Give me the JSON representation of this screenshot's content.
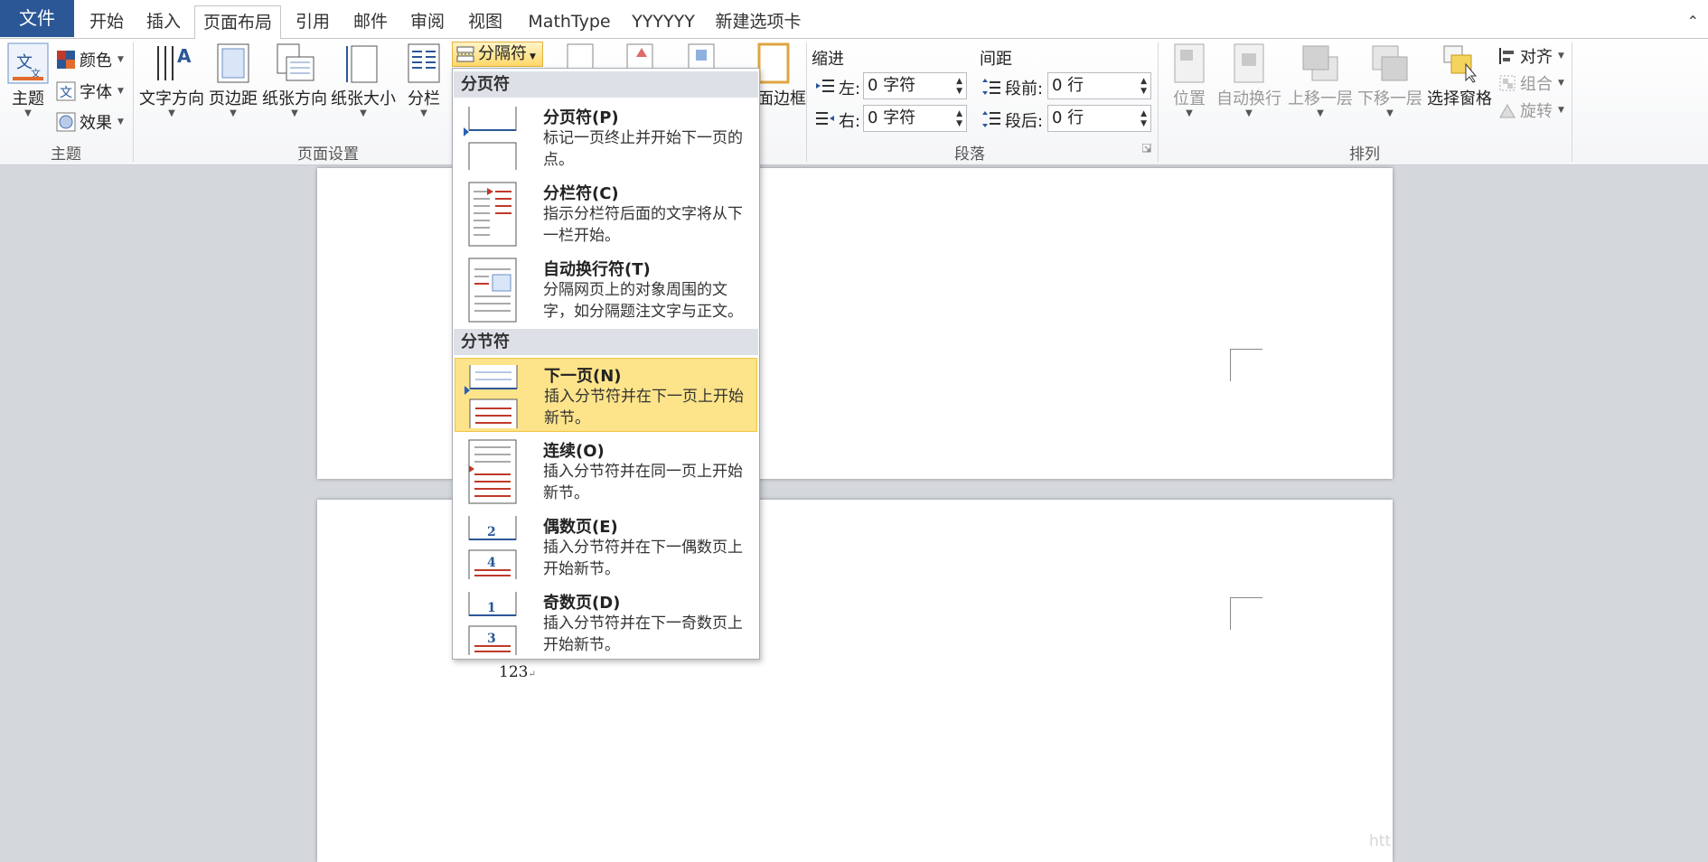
{
  "tabs": {
    "file": "文件",
    "items": [
      "开始",
      "插入",
      "页面布局",
      "引用",
      "邮件",
      "审阅",
      "视图",
      "MathType",
      "YYYYYY",
      "新建选项卡"
    ],
    "active_index": 2
  },
  "ribbon": {
    "theme": {
      "group_label": "主题",
      "theme_button": "主题",
      "colors": "颜色",
      "fonts": "字体",
      "effects": "效果"
    },
    "page_setup": {
      "group_label": "页面设置",
      "text_direction": "文字方向",
      "margins": "页边距",
      "orientation": "纸张方向",
      "size": "纸张大小",
      "columns": "分栏",
      "breaks": "分隔符",
      "page_borders_partial": "面边框"
    },
    "paragraph": {
      "group_label": "段落",
      "indent_title": "缩进",
      "spacing_title": "间距",
      "left_label": "左:",
      "left_value": "0 字符",
      "right_label": "右:",
      "right_value": "0 字符",
      "before_label": "段前:",
      "before_value": "0 行",
      "after_label": "段后:",
      "after_value": "0 行"
    },
    "arrange": {
      "group_label": "排列",
      "position": "位置",
      "wrap": "自动换行",
      "bring_forward": "上移一层",
      "send_backward": "下移一层",
      "selection_pane": "选择窗格",
      "align": "对齐",
      "group": "组合",
      "rotate": "旋转"
    }
  },
  "breaks_menu": {
    "page_breaks_header": "分页符",
    "section_breaks_header": "分节符",
    "items": [
      {
        "title": "分页符(P)",
        "desc": "标记一页终止并开始下一页的点。"
      },
      {
        "title": "分栏符(C)",
        "desc": "指示分栏符后面的文字将从下一栏开始。"
      },
      {
        "title": "自动换行符(T)",
        "desc": "分隔网页上的对象周围的文字，如分隔题注文字与正文。"
      },
      {
        "title": "下一页(N)",
        "desc": "插入分节符并在下一页上开始新节。"
      },
      {
        "title": "连续(O)",
        "desc": "插入分节符并在同一页上开始新节。"
      },
      {
        "title": "偶数页(E)",
        "desc": "插入分节符并在下一偶数页上开始新节。"
      },
      {
        "title": "奇数页(D)",
        "desc": "插入分节符并在下一奇数页上开始新节。"
      }
    ],
    "highlighted_index": 3
  },
  "document": {
    "text": "123",
    "paragraph_mark": "↵"
  },
  "watermark": "htt"
}
